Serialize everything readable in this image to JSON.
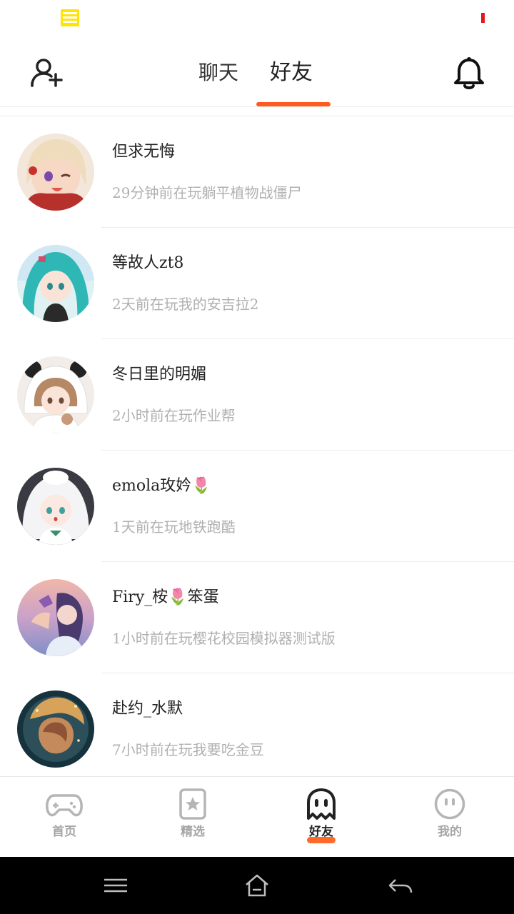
{
  "header": {
    "tabs": [
      {
        "label": "聊天",
        "active": false
      },
      {
        "label": "好友",
        "active": true
      }
    ],
    "accent_color": "#ff5a1f"
  },
  "friends": [
    {
      "name": "但求无悔",
      "status": "29分钟前在玩躺平植物战僵尸",
      "avatar": "anime-girl-blonde"
    },
    {
      "name": "等故人zt8",
      "status": "2天前在玩我的安吉拉2",
      "avatar": "anime-girl-teal-twintails"
    },
    {
      "name": "冬日里的明媚",
      "status": "2小时前在玩作业帮",
      "avatar": "anime-girl-panda-hood"
    },
    {
      "name": "emolа玫妗🌷",
      "status": "1天前在玩地铁跑酷",
      "avatar": "anime-girl-white-hair"
    },
    {
      "name": "Firy_桉🌷笨蛋",
      "status": "1小时前在玩樱花校园模拟器测试版",
      "avatar": "anime-girl-sunset"
    },
    {
      "name": "赴约_水默",
      "status": "7小时前在玩我要吃金豆",
      "avatar": "girl-starry-portrait"
    }
  ],
  "bottom_nav": [
    {
      "label": "首页",
      "icon": "gamepad-icon",
      "active": false
    },
    {
      "label": "精选",
      "icon": "star-card-icon",
      "active": false
    },
    {
      "label": "好友",
      "icon": "ghost-icon",
      "active": true
    },
    {
      "label": "我的",
      "icon": "face-icon",
      "active": false
    }
  ],
  "colors": {
    "active_tab_underline": "#ff5a1f",
    "nav_active_underline": "#ff6a2a",
    "inactive_text": "#a6a6a6",
    "status_text": "#b0b0b0"
  }
}
